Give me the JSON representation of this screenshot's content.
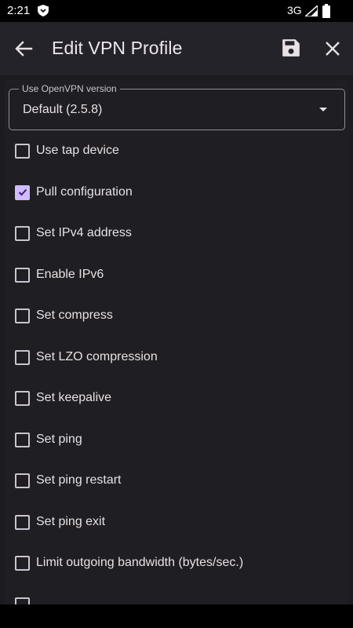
{
  "status_bar": {
    "time": "2:21",
    "network": "3G",
    "icons": [
      "shield-icon",
      "signal-icon",
      "battery-icon"
    ]
  },
  "app_bar": {
    "title": "Edit VPN Profile",
    "icons": [
      "back-arrow-icon",
      "save-icon",
      "close-icon"
    ]
  },
  "openvpn_version": {
    "label": "Use OpenVPN version",
    "value": "Default (2.5.8)"
  },
  "options": [
    {
      "label": "Use tap device",
      "checked": false
    },
    {
      "label": "Pull configuration",
      "checked": true
    },
    {
      "label": "Set IPv4 address",
      "checked": false
    },
    {
      "label": "Enable IPv6",
      "checked": false
    },
    {
      "label": "Set compress",
      "checked": false
    },
    {
      "label": "Set LZO compression",
      "checked": false
    },
    {
      "label": "Set keepalive",
      "checked": false
    },
    {
      "label": "Set ping",
      "checked": false
    },
    {
      "label": "Set ping restart",
      "checked": false
    },
    {
      "label": "Set ping exit",
      "checked": false
    },
    {
      "label": "Limit outgoing bandwidth (bytes/sec.)",
      "checked": false
    }
  ],
  "colors": {
    "background": "#1c1b1f",
    "accent": "#d0bcff",
    "app_bar": "#25232a"
  }
}
